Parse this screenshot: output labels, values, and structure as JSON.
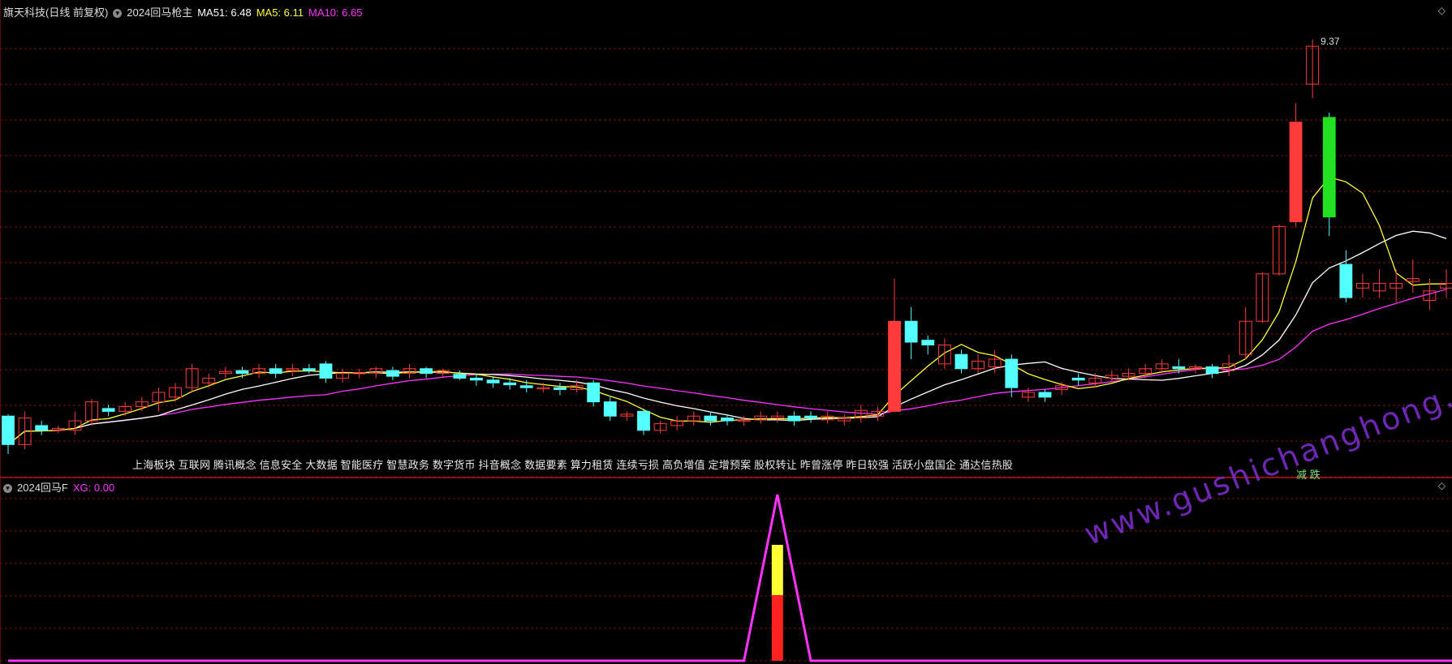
{
  "header_main": {
    "stock": "旗天科技(日线 前复权)",
    "indicator": "2024回马枪主",
    "ma51": "MA51: 6.48",
    "ma5": "MA5: 6.11",
    "ma10": "MA10: 6.65",
    "collapse_icon": "chevron-circle-icon"
  },
  "header_sub": {
    "indicator": "2024回马F",
    "xg": "XG: 0.00"
  },
  "concepts": "上海板块 互联网 腾讯概念 信息安全 大数据 智能医疗 智慧政务 数字货币 抖音概念 数据要素 算力租赁 连续亏损 高负增值 定增预案 股权转让 昨曾涨停 昨日较强 活跃小盘国企 通达信热股",
  "max_label": "9.37",
  "marker": "减 跌",
  "watermark": "www.gushichanghong.com",
  "colors": {
    "up": "#ff3b3b",
    "down": "#54ffff",
    "ma5": "#ffff33",
    "ma10": "#ff33ff",
    "ma51": "#ffffff",
    "grid": "#7a1010",
    "xg": "#ff33ff"
  },
  "chart_data": [
    {
      "type": "candlestick",
      "title": "2024回马枪主",
      "ylim": [
        5.0,
        9.6
      ],
      "grid": true,
      "candles": [
        [
          5.4,
          5.1,
          5.0,
          5.42
        ],
        [
          5.1,
          5.38,
          5.05,
          5.45
        ],
        [
          5.3,
          5.25,
          5.2,
          5.35
        ],
        [
          5.25,
          5.27,
          5.22,
          5.3
        ],
        [
          5.25,
          5.35,
          5.2,
          5.45
        ],
        [
          5.35,
          5.55,
          5.3,
          5.58
        ],
        [
          5.48,
          5.45,
          5.4,
          5.52
        ],
        [
          5.45,
          5.5,
          5.4,
          5.55
        ],
        [
          5.5,
          5.55,
          5.45,
          5.6
        ],
        [
          5.55,
          5.65,
          5.45,
          5.7
        ],
        [
          5.6,
          5.7,
          5.55,
          5.75
        ],
        [
          5.7,
          5.9,
          5.65,
          5.95
        ],
        [
          5.75,
          5.8,
          5.7,
          5.85
        ],
        [
          5.85,
          5.87,
          5.8,
          5.92
        ],
        [
          5.88,
          5.85,
          5.8,
          5.92
        ],
        [
          5.85,
          5.9,
          5.8,
          5.95
        ],
        [
          5.9,
          5.85,
          5.8,
          5.95
        ],
        [
          5.88,
          5.9,
          5.82,
          5.95
        ],
        [
          5.9,
          5.88,
          5.85,
          5.95
        ],
        [
          5.95,
          5.8,
          5.75,
          5.98
        ],
        [
          5.8,
          5.85,
          5.75,
          5.9
        ],
        [
          5.85,
          5.86,
          5.8,
          5.9
        ],
        [
          5.86,
          5.9,
          5.8,
          5.92
        ],
        [
          5.88,
          5.82,
          5.78,
          5.92
        ],
        [
          5.85,
          5.9,
          5.8,
          5.95
        ],
        [
          5.9,
          5.85,
          5.8,
          5.92
        ],
        [
          5.85,
          5.88,
          5.8,
          5.9
        ],
        [
          5.84,
          5.8,
          5.78,
          5.88
        ],
        [
          5.8,
          5.78,
          5.72,
          5.85
        ],
        [
          5.78,
          5.75,
          5.7,
          5.82
        ],
        [
          5.75,
          5.73,
          5.68,
          5.8
        ],
        [
          5.72,
          5.7,
          5.65,
          5.78
        ],
        [
          5.7,
          5.7,
          5.65,
          5.75
        ],
        [
          5.7,
          5.68,
          5.62,
          5.75
        ],
        [
          5.68,
          5.72,
          5.65,
          5.78
        ],
        [
          5.75,
          5.55,
          5.5,
          5.78
        ],
        [
          5.55,
          5.4,
          5.35,
          5.6
        ],
        [
          5.4,
          5.42,
          5.35,
          5.45
        ],
        [
          5.45,
          5.25,
          5.2,
          5.48
        ],
        [
          5.25,
          5.32,
          5.22,
          5.35
        ],
        [
          5.3,
          5.35,
          5.25,
          5.4
        ],
        [
          5.35,
          5.4,
          5.3,
          5.45
        ],
        [
          5.4,
          5.35,
          5.3,
          5.45
        ],
        [
          5.38,
          5.35,
          5.3,
          5.42
        ],
        [
          5.35,
          5.36,
          5.3,
          5.4
        ],
        [
          5.36,
          5.4,
          5.32,
          5.45
        ],
        [
          5.38,
          5.4,
          5.33,
          5.45
        ],
        [
          5.4,
          5.35,
          5.3,
          5.45
        ],
        [
          5.4,
          5.38,
          5.33,
          5.45
        ],
        [
          5.36,
          5.4,
          5.32,
          5.45
        ],
        [
          5.35,
          5.38,
          5.3,
          5.42
        ],
        [
          5.38,
          5.46,
          5.33,
          5.52
        ],
        [
          5.4,
          5.45,
          5.35,
          5.5
        ],
        [
          5.45,
          6.4,
          5.44,
          6.85
        ],
        [
          6.4,
          6.18,
          6.0,
          6.55
        ],
        [
          6.2,
          6.15,
          6.05,
          6.25
        ],
        [
          5.95,
          6.15,
          5.9,
          6.22
        ],
        [
          6.05,
          5.9,
          5.85,
          6.1
        ],
        [
          5.9,
          5.98,
          5.85,
          6.05
        ],
        [
          5.92,
          6.0,
          5.85,
          6.1
        ],
        [
          6.0,
          5.7,
          5.6,
          6.05
        ],
        [
          5.6,
          5.65,
          5.55,
          5.7
        ],
        [
          5.65,
          5.6,
          5.55,
          5.68
        ],
        [
          5.68,
          5.72,
          5.62,
          5.76
        ],
        [
          5.8,
          5.78,
          5.72,
          5.85
        ],
        [
          5.75,
          5.8,
          5.7,
          5.85
        ],
        [
          5.8,
          5.83,
          5.75,
          5.88
        ],
        [
          5.82,
          5.85,
          5.78,
          5.9
        ],
        [
          5.85,
          5.9,
          5.8,
          5.95
        ],
        [
          5.9,
          5.95,
          5.85,
          6.0
        ],
        [
          5.92,
          5.9,
          5.85,
          6.0
        ],
        [
          5.9,
          5.92,
          5.85,
          5.95
        ],
        [
          5.92,
          5.85,
          5.8,
          5.95
        ],
        [
          5.88,
          5.95,
          5.82,
          6.05
        ],
        [
          6.05,
          6.4,
          6.0,
          6.55
        ],
        [
          6.4,
          6.9,
          6.38,
          6.92
        ],
        [
          6.9,
          7.4,
          6.88,
          7.42
        ],
        [
          7.45,
          8.5,
          7.4,
          8.7
        ],
        [
          8.9,
          9.3,
          8.75,
          9.37
        ],
        [
          8.55,
          7.5,
          7.3,
          8.6
        ],
        [
          7.0,
          6.65,
          6.6,
          7.15
        ],
        [
          6.75,
          6.8,
          6.65,
          6.9
        ],
        [
          6.72,
          6.8,
          6.65,
          6.95
        ],
        [
          6.75,
          6.8,
          6.6,
          6.95
        ],
        [
          6.82,
          6.85,
          6.7,
          7.05
        ],
        [
          6.62,
          6.72,
          6.52,
          6.85
        ],
        [
          6.75,
          6.8,
          6.65,
          6.95
        ]
      ]
    },
    {
      "type": "line",
      "title": "2024回马F",
      "x": [
        0,
        40,
        44,
        46,
        48,
        52,
        89
      ],
      "values": [
        0,
        0,
        0,
        1,
        0,
        0,
        0
      ],
      "ylim": [
        0,
        1
      ],
      "grid": true
    }
  ]
}
